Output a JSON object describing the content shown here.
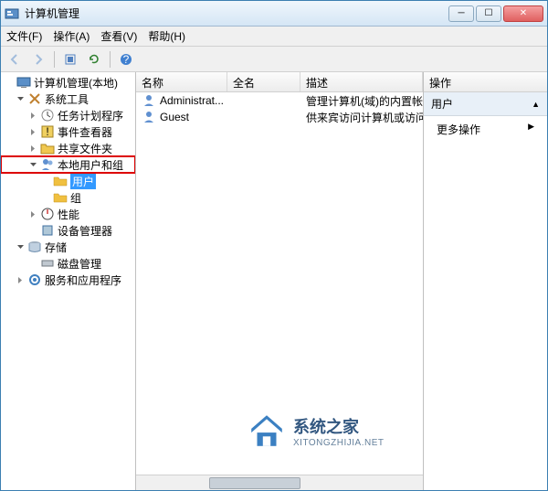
{
  "window": {
    "title": "计算机管理"
  },
  "menubar": {
    "file": "文件(F)",
    "action": "操作(A)",
    "view": "查看(V)",
    "help": "帮助(H)"
  },
  "tree": {
    "root": "计算机管理(本地)",
    "system_tools": "系统工具",
    "task_scheduler": "任务计划程序",
    "event_viewer": "事件查看器",
    "shared_folders": "共享文件夹",
    "local_users_groups": "本地用户和组",
    "users": "用户",
    "groups": "组",
    "performance": "性能",
    "device_manager": "设备管理器",
    "storage": "存储",
    "disk_management": "磁盘管理",
    "services_apps": "服务和应用程序"
  },
  "list": {
    "columns": {
      "name": "名称",
      "fullname": "全名",
      "description": "描述"
    },
    "rows": [
      {
        "name": "Administrat...",
        "fullname": "",
        "description": "管理计算机(域)的内置帐户"
      },
      {
        "name": "Guest",
        "fullname": "",
        "description": "供来宾访问计算机或访问域"
      }
    ]
  },
  "actions": {
    "header": "操作",
    "title": "用户",
    "more": "更多操作"
  },
  "watermark": {
    "big": "系统之家",
    "small": "XITONGZHIJIA.NET"
  }
}
